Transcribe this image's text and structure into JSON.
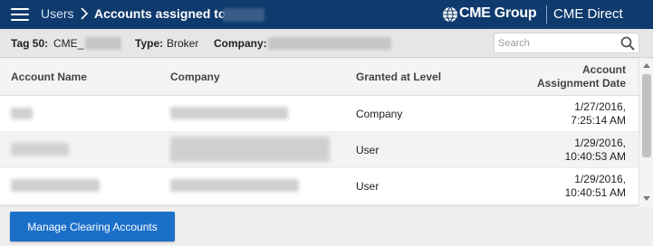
{
  "header": {
    "breadcrumb_parent": "Users",
    "title": "Accounts assigned to",
    "brand_name": "CME Group",
    "product_name": "CME Direct"
  },
  "info_bar": {
    "tag_label": "Tag 50:",
    "tag_value": "CME_",
    "type_label": "Type:",
    "type_value": "Broker",
    "company_label": "Company:"
  },
  "search": {
    "placeholder": "Search"
  },
  "table": {
    "columns": [
      "Account Name",
      "Company",
      "Granted at Level",
      "Account Assignment Date"
    ],
    "date_header_line1": "Account",
    "date_header_line2": "Assignment Date",
    "rows": [
      {
        "level": "Company",
        "date_line1": "1/27/2016,",
        "date_line2": "7:25:14 AM"
      },
      {
        "level": "User",
        "date_line1": "1/29/2016,",
        "date_line2": "10:40:53 AM"
      },
      {
        "level": "User",
        "date_line1": "1/29/2016,",
        "date_line2": "10:40:51 AM"
      }
    ]
  },
  "footer": {
    "manage_button_label": "Manage Clearing Accounts"
  },
  "colors": {
    "header_bg": "#0e3a6e",
    "button_bg": "#1a6fc9"
  },
  "icons": [
    "menu-icon",
    "chevron-right-icon",
    "cme-globe-icon",
    "search-icon"
  ]
}
